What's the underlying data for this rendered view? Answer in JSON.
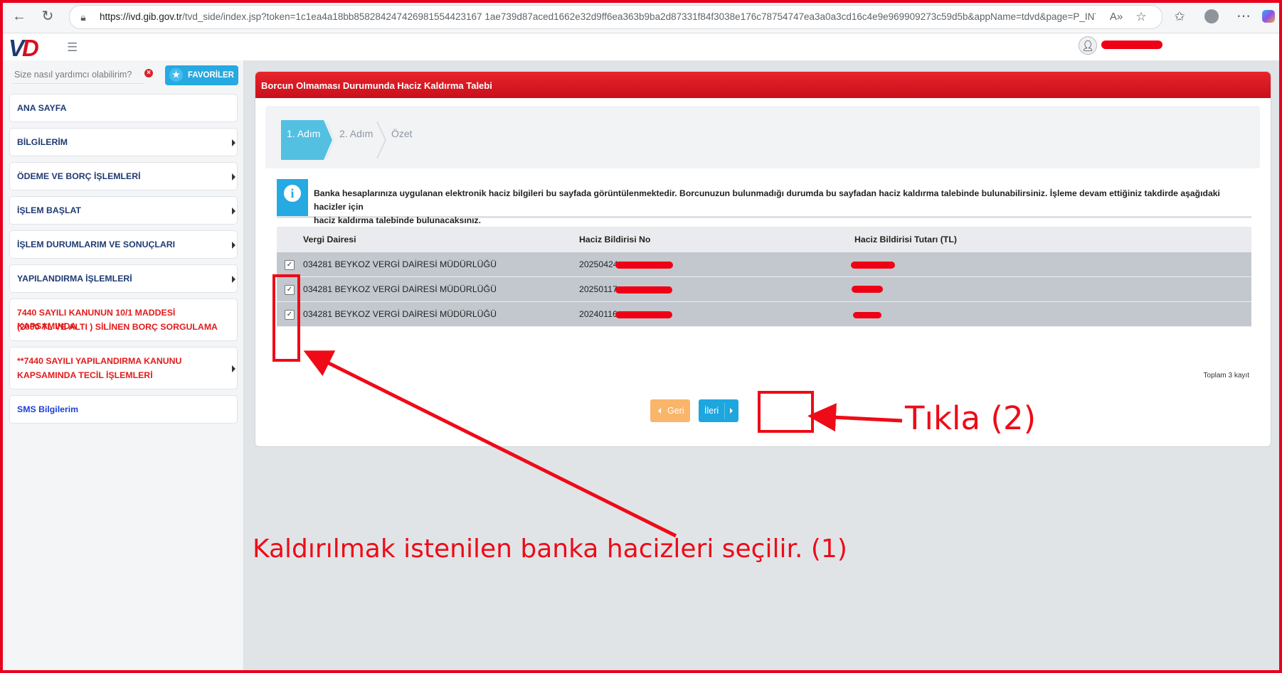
{
  "browser": {
    "url_domain": "https://ivd.gib.gov.tr",
    "url_rest": "/tvd_side/index.jsp?token=1c1ea4a18bb858284247426981554423167 1ae739d87aced1662e32d9ff6ea363b9ba2d87331f84f3038e176c78754747ea3a0a3cd16c4e9e969909273c59d5b&appName=tdvd&page=P_INTVRG_IN..."
  },
  "app": {
    "logo_v": "V",
    "logo_d": "D"
  },
  "sidebar": {
    "search_placeholder": "Size nasıl yardımcı olabilirim?",
    "favorites_label": "FAVORİLER",
    "items": [
      {
        "label": "ANA SAYFA"
      },
      {
        "label": "BİLGİLERİM"
      },
      {
        "label": "ÖDEME VE BORÇ İŞLEMLERİ"
      },
      {
        "label": "İŞLEM BAŞLAT"
      },
      {
        "label": "İŞLEM DURUMLARIM VE SONUÇLARI"
      },
      {
        "label": "YAPILANDIRMA İŞLEMLERİ"
      },
      {
        "label_line1": "7440 SAYILI KANUNUN 10/1 MADDESİ KAPSAMINDA",
        "label_line2": "(2000 TL VE ALTI ) SİLİNEN BORÇ SORGULAMA"
      },
      {
        "label_line1": "**7440 SAYILI YAPILANDIRMA KANUNU",
        "label_line2": "KAPSAMINDA TECİL İŞLEMLERİ"
      },
      {
        "label": "SMS Bilgilerim"
      }
    ]
  },
  "panel": {
    "title": "Borcun Olmaması Durumunda Haciz Kaldırma Talebi",
    "steps": [
      "1. Adım",
      "2. Adım",
      "Özet"
    ],
    "info_line1": "Banka hesaplarınıza uygulanan elektronik haciz bilgileri bu sayfada görüntülenmektedir. Borcunuzun bulunmadığı durumda bu sayfadan haciz kaldırma talebinde bulunabilirsiniz. İşleme devam ettiğiniz takdirde aşağıdaki hacizler için",
    "info_line2": "haciz kaldırma talebinde bulunacaksınız.",
    "table": {
      "headers": [
        "Vergi Dairesi",
        "Haciz Bildirisi No",
        "Haciz Bildirisi Tutarı (TL)"
      ],
      "rows": [
        {
          "checked": true,
          "office": "034281 BEYKOZ VERGİ DAİRESİ MÜDÜRLÜĞÜ",
          "no": "20250424"
        },
        {
          "checked": true,
          "office": "034281 BEYKOZ VERGİ DAİRESİ MÜDÜRLÜĞÜ",
          "no": "20250117"
        },
        {
          "checked": true,
          "office": "034281 BEYKOZ VERGİ DAİRESİ MÜDÜRLÜĞÜ",
          "no": "20240116"
        }
      ],
      "total": "Toplam 3 kayıt"
    },
    "back_label": "Geri",
    "next_label": "İleri"
  },
  "annotations": {
    "click_note": "Tıkla (2)",
    "select_note": "Kaldırılmak istenilen banka hacizleri seçilir.  (1)"
  },
  "colors": {
    "brand_red": "#d5101f",
    "accent_blue": "#27a9e1",
    "annotation_red": "#ee0b17"
  }
}
